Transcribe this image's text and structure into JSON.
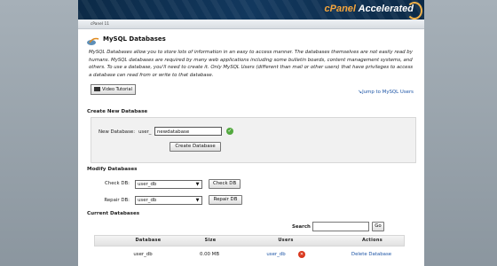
{
  "app": {
    "logo_brand": "cPanel",
    "logo_suffix": "Accelerated",
    "breadcrumb": "cPanel 11"
  },
  "section": {
    "title": "MySQL Databases",
    "description": "MySQL Databases allow you to store lots of information in an easy to access manner. The databases themselves are not easily read by humans. MySQL databases are required by many web applications including some bulletin boards, content management systems, and others. To use a database, you'll need to create it. Only MySQL Users (different than mail or other users) that have privileges to access a database can read from or write to that database.",
    "video_button": "Video Tutorial",
    "jump_link": "Jump to MySQL Users"
  },
  "create": {
    "heading": "Create New Database",
    "label": "New Database:",
    "prefix": "user_",
    "input_value": "newdatabase",
    "button": "Create Database"
  },
  "modify": {
    "heading": "Modify Databases",
    "check_label": "Check DB:",
    "check_selected": "user_db",
    "check_button": "Check DB",
    "repair_label": "Repair DB:",
    "repair_selected": "user_db",
    "repair_button": "Repair DB"
  },
  "current": {
    "heading": "Current Databases",
    "search_label": "Search",
    "search_value": "",
    "go_button": "Go",
    "columns": [
      "Database",
      "Size",
      "Users",
      "Actions"
    ],
    "rows": [
      {
        "database": "user_db",
        "size": "0.00 MB",
        "user": "user_db",
        "action": "Delete Database"
      }
    ]
  },
  "colors": {
    "accent_link": "#1d55a6",
    "header_bg": "#0c2a47",
    "logo_accent": "#f4a53c"
  },
  "icons": [
    "mysql-icon",
    "play-icon",
    "jump-arrow-icon",
    "valid-check-icon",
    "dropdown-caret-icon",
    "remove-user-icon"
  ]
}
